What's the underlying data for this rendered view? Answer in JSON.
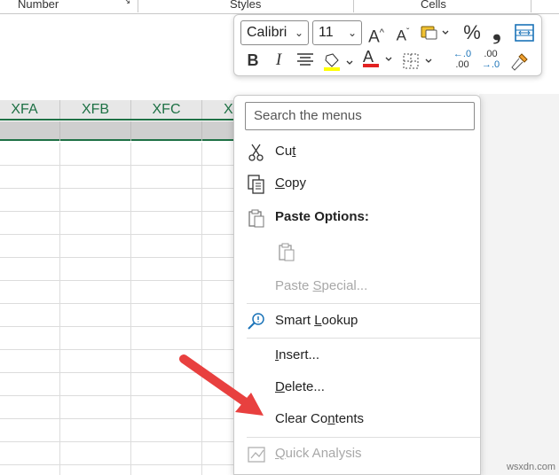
{
  "ribbon": {
    "groups": [
      "Number",
      "Styles",
      "Cells"
    ]
  },
  "sheet": {
    "columns": [
      "XFA",
      "XFB",
      "XFC",
      "X"
    ],
    "accent_color": "#1e7145"
  },
  "mini_toolbar": {
    "font_name": "Calibri",
    "font_size": "11",
    "bold": "B",
    "italic": "I",
    "increase_font": "A",
    "decrease_font": "A",
    "percent": "%",
    "comma": "❟",
    "font_color_letter": "A",
    "dec_increase": ".00",
    "dec_decrease": ".00",
    "dec_increase_arrow": "←.0",
    "dec_decrease_arrow": "→.0"
  },
  "context_menu": {
    "search_placeholder": "Search the menus",
    "cut": {
      "pre": "Cu",
      "key": "t",
      "post": ""
    },
    "copy": {
      "pre": "",
      "key": "C",
      "post": "opy"
    },
    "paste_options": "Paste Options:",
    "paste_special": {
      "pre": "Paste ",
      "key": "S",
      "post": "pecial..."
    },
    "smart_lookup": {
      "pre": "Smart ",
      "key": "L",
      "post": "ookup"
    },
    "insert": {
      "pre": "",
      "key": "I",
      "post": "nsert..."
    },
    "delete": {
      "pre": "",
      "key": "D",
      "post": "elete..."
    },
    "clear_contents": {
      "pre": "Clear Co",
      "key": "n",
      "post": "tents"
    },
    "quick_analysis": {
      "pre": "",
      "key": "Q",
      "post": "uick Analysis"
    }
  },
  "arrow_color": "#e8403f",
  "watermark": "wsxdn.com"
}
